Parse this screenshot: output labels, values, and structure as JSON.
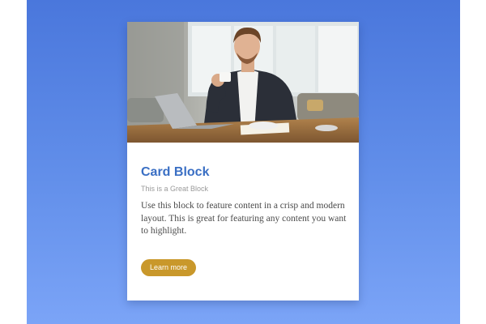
{
  "card": {
    "title": "Card Block",
    "subtitle": "This is a Great Block",
    "text": "Use this block to feature content in a crisp and modern layout. This is great for featuring any content you want to highlight.",
    "button_label": "Learn more"
  },
  "colors": {
    "background_top": "#4a77dc",
    "background_bottom": "#7ba4f7",
    "title": "#3a6fc4",
    "button": "#c9982b"
  },
  "image": {
    "subject": "businessman-with-cup-and-laptop-photo"
  }
}
